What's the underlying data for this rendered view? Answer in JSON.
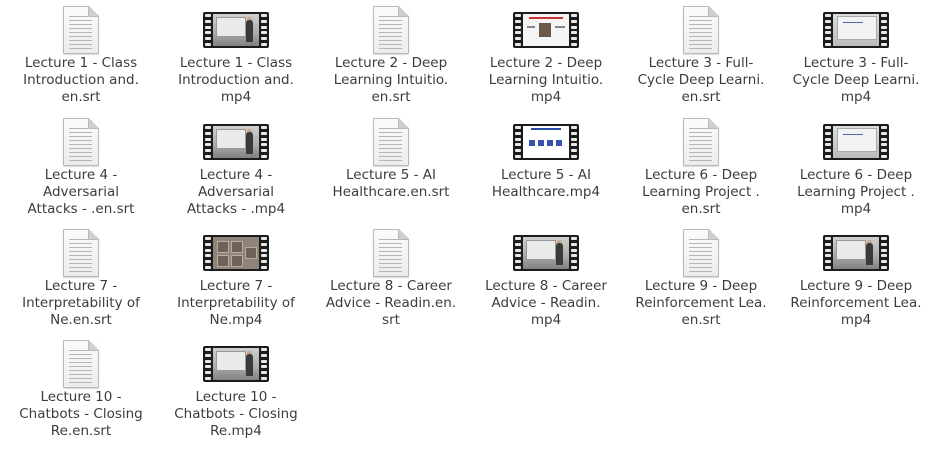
{
  "files": [
    {
      "name": "Lecture 1 - Class\nIntroduction and.\nen.srt",
      "icon": "text-file-icon",
      "kind": "srt",
      "scene": ""
    },
    {
      "name": "Lecture 1 - Class\nIntroduction and.\nmp4",
      "icon": "video-file-icon",
      "kind": "mp4",
      "scene": "room"
    },
    {
      "name": "Lecture 2 - Deep\nLearning Intuitio.\nen.srt",
      "icon": "text-file-icon",
      "kind": "srt",
      "scene": ""
    },
    {
      "name": "Lecture 2 - Deep\nLearning Intuitio.\nmp4",
      "icon": "video-file-icon",
      "kind": "mp4",
      "scene": "slide"
    },
    {
      "name": "Lecture 3 - Full-\nCycle Deep Learni.\nen.srt",
      "icon": "text-file-icon",
      "kind": "srt",
      "scene": ""
    },
    {
      "name": "Lecture 3 - Full-\nCycle Deep Learni.\nmp4",
      "icon": "video-file-icon",
      "kind": "mp4",
      "scene": "whiteboard"
    },
    {
      "name": "Lecture 4 -\nAdversarial\nAttacks - .en.srt",
      "icon": "text-file-icon",
      "kind": "srt",
      "scene": ""
    },
    {
      "name": "Lecture 4 -\nAdversarial\nAttacks - .mp4",
      "icon": "video-file-icon",
      "kind": "mp4",
      "scene": "room"
    },
    {
      "name": "Lecture 5 - AI\nHealthcare.en.srt",
      "icon": "text-file-icon",
      "kind": "srt",
      "scene": ""
    },
    {
      "name": "Lecture 5 - AI\nHealthcare.mp4",
      "icon": "video-file-icon",
      "kind": "mp4",
      "scene": "chart"
    },
    {
      "name": "Lecture 6 - Deep\nLearning Project .\nen.srt",
      "icon": "text-file-icon",
      "kind": "srt",
      "scene": ""
    },
    {
      "name": "Lecture 6 - Deep\nLearning Project .\nmp4",
      "icon": "video-file-icon",
      "kind": "mp4",
      "scene": "whiteboard"
    },
    {
      "name": "Lecture 7 -\nInterpretability of\nNe.en.srt",
      "icon": "text-file-icon",
      "kind": "srt",
      "scene": ""
    },
    {
      "name": "Lecture 7 -\nInterpretability of\nNe.mp4",
      "icon": "video-file-icon",
      "kind": "mp4",
      "scene": "texture"
    },
    {
      "name": "Lecture 8 - Career\nAdvice - Readin.en.\nsrt",
      "icon": "text-file-icon",
      "kind": "srt",
      "scene": ""
    },
    {
      "name": "Lecture 8 - Career\nAdvice - Readin.\nmp4",
      "icon": "video-file-icon",
      "kind": "mp4",
      "scene": "room"
    },
    {
      "name": "Lecture 9 - Deep\nReinforcement Lea.\nen.srt",
      "icon": "text-file-icon",
      "kind": "srt",
      "scene": ""
    },
    {
      "name": "Lecture 9 - Deep\nReinforcement Lea.\nmp4",
      "icon": "video-file-icon",
      "kind": "mp4",
      "scene": "room"
    },
    {
      "name": "Lecture 10 -\nChatbots - Closing\nRe.en.srt",
      "icon": "text-file-icon",
      "kind": "srt",
      "scene": ""
    },
    {
      "name": "Lecture 10 -\nChatbots - Closing\nRe.mp4",
      "icon": "video-file-icon",
      "kind": "mp4",
      "scene": "room"
    }
  ]
}
